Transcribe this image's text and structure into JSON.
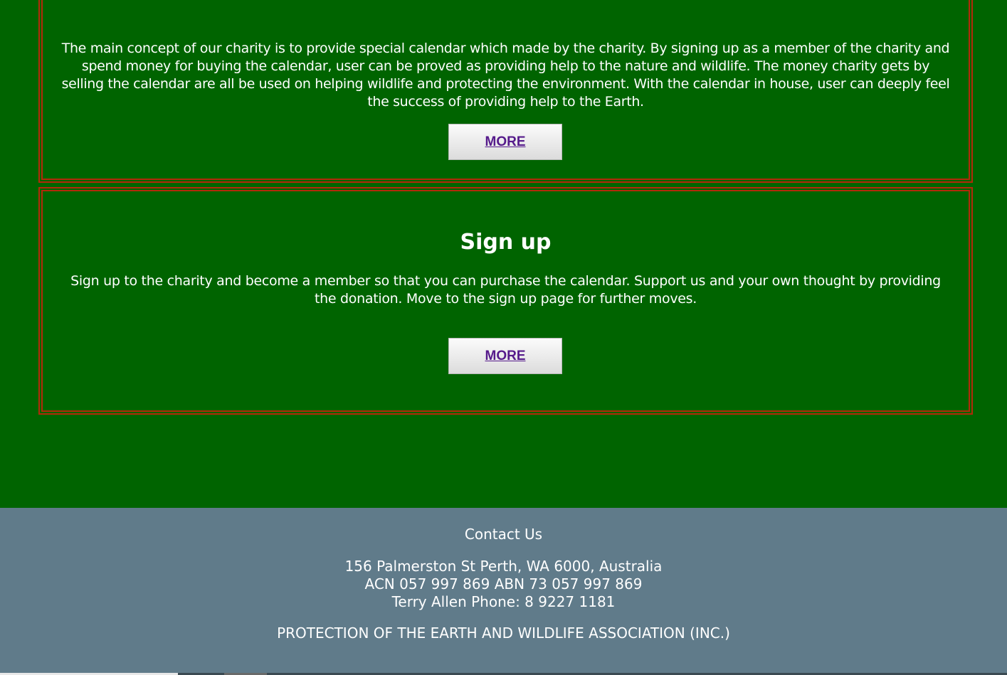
{
  "banner": {
    "colors": [
      "#1aa6e0",
      "#e8255a",
      "#f5b400",
      "#e86b1f",
      "#1aa6e0",
      "#10a04a",
      "#3f3d98",
      "#a8d05a",
      "#7fc241",
      "#76cdee",
      "#d43a8c",
      "#1aa6e0",
      "#10a04a",
      "#e86b1f",
      "#f7c21a"
    ]
  },
  "concept": {
    "text": "The main concept of our charity is to provide special calendar which made by the charity. By signing up as a member of the charity and spend money for buying the calendar, user can be proved as providing help to the nature and wildlife. The money charity gets by selling the calendar are all be used on helping wildlife and protecting the environment. With the calendar in house, user can deeply feel the success of providing help to the Earth.",
    "button_label": "MORE"
  },
  "signup": {
    "title": "Sign up",
    "text": "Sign up to the charity and become a member so that you can purchase the calendar. Support us and your own thought by providing the donation. Move to the sign up page for further moves.",
    "button_label": "MORE"
  },
  "footer": {
    "contact_title": "Contact Us",
    "address_line1": "156 Palmerston St Perth, WA 6000, Australia",
    "address_line2": "ACN 057 997 869 ABN 73 057 997 869",
    "address_line3": "Terry Allen Phone: 8 9227 1181",
    "organization": "PROTECTION OF THE EARTH AND WILDLIFE ASSOCIATION (INC.)"
  },
  "colors": {
    "page_background": "#006400",
    "panel_border": "#b22a0a",
    "footer_background": "#607b8a",
    "link_text": "#551a8b"
  }
}
